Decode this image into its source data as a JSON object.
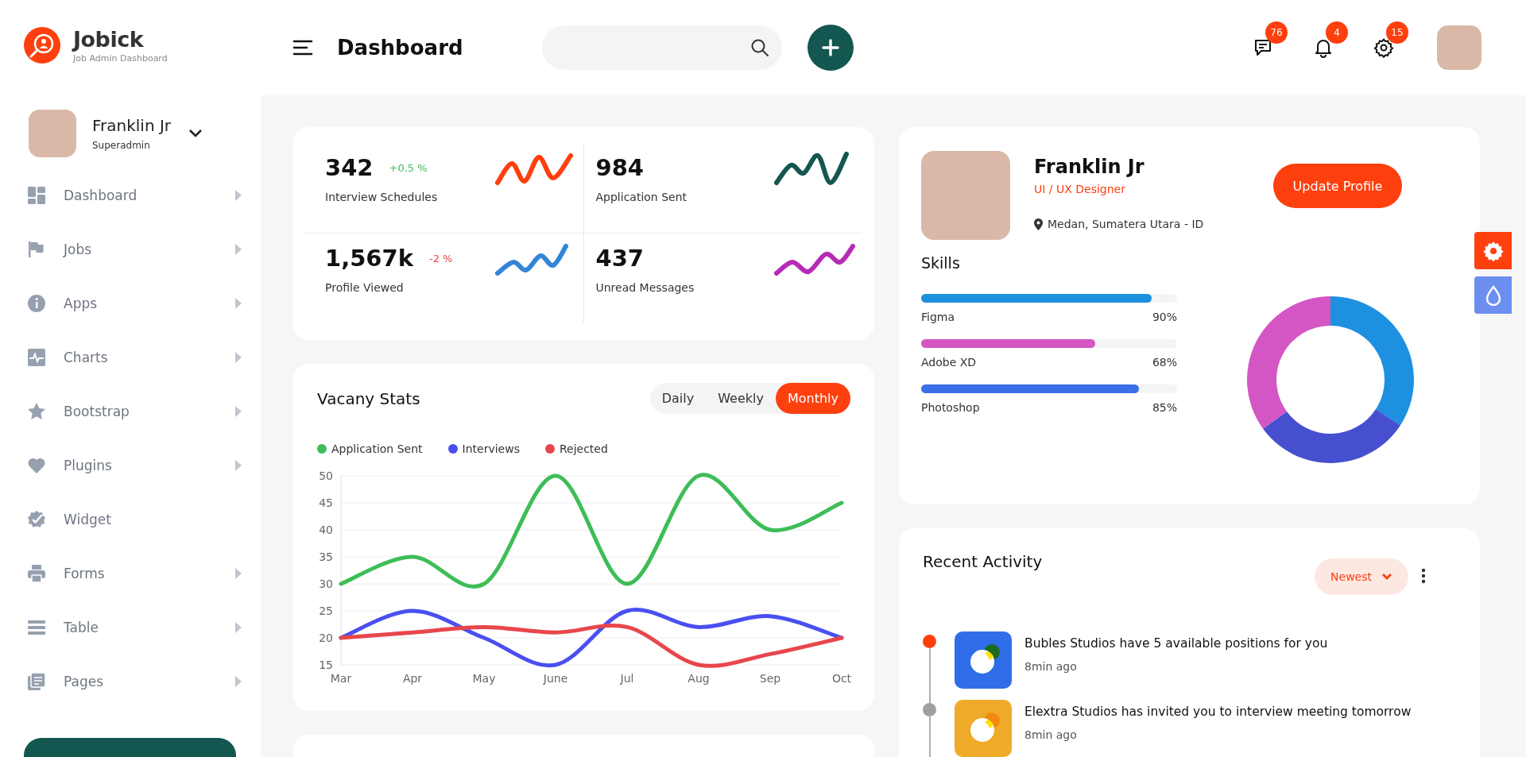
{
  "brand": {
    "name": "Jobick",
    "tagline": "Job Admin Dashboard"
  },
  "header": {
    "title": "Dashboard",
    "badges": [
      {
        "count": "76"
      },
      {
        "count": "4"
      },
      {
        "count": "15"
      }
    ]
  },
  "user": {
    "name": "Franklin Jr",
    "role": "Superadmin"
  },
  "sidebar": {
    "items": [
      {
        "label": "Dashboard",
        "has_submenu": true
      },
      {
        "label": "Jobs",
        "has_submenu": true
      },
      {
        "label": "Apps",
        "has_submenu": true
      },
      {
        "label": "Charts",
        "has_submenu": true
      },
      {
        "label": "Bootstrap",
        "has_submenu": true
      },
      {
        "label": "Plugins",
        "has_submenu": true
      },
      {
        "label": "Widget",
        "has_submenu": false
      },
      {
        "label": "Forms",
        "has_submenu": true
      },
      {
        "label": "Table",
        "has_submenu": true
      },
      {
        "label": "Pages",
        "has_submenu": true
      }
    ]
  },
  "stats": [
    {
      "value": "342",
      "change": {
        "text": "+0.5 %",
        "color": "#3ebd58"
      },
      "label": "Interview Schedules",
      "color": "#fe3f0e"
    },
    {
      "value": "984",
      "label": "Application Sent",
      "color": "#145650"
    },
    {
      "value": "1,567k",
      "change": {
        "text": "-2 %",
        "color": "#e8464b"
      },
      "label": "Profile Viewed",
      "color": "#3385d6"
    },
    {
      "value": "437",
      "label": "Unread Messages",
      "color": "#b62bb6"
    }
  ],
  "vacancy_stats": {
    "title": "Vacany Stats",
    "tabs": [
      {
        "label": "Daily",
        "selected": false
      },
      {
        "label": "Weekly",
        "selected": false
      },
      {
        "label": "Monthly",
        "selected": true
      }
    ],
    "chart_data": {
      "type": "line",
      "grid": true,
      "categories": [
        "Mar",
        "Apr",
        "May",
        "June",
        "Jul",
        "Aug",
        "Sep",
        "Oct"
      ],
      "ylim": [
        15,
        50
      ],
      "yticks": [
        15,
        20,
        25,
        30,
        35,
        40,
        45,
        50
      ],
      "series": [
        {
          "name": "Application Sent",
          "color": "#3ebd58",
          "values": [
            30,
            35,
            30,
            50,
            30,
            50,
            40,
            45
          ]
        },
        {
          "name": "Interviews",
          "color": "#4a4ff0",
          "values": [
            20,
            25,
            20,
            15,
            25,
            22,
            24,
            20
          ]
        },
        {
          "name": "Rejected",
          "color": "#e8464b",
          "values": [
            20,
            21,
            22,
            21,
            22,
            15,
            17,
            20
          ]
        }
      ]
    }
  },
  "profile": {
    "name": "Franklin Jr",
    "role": "UI / UX Designer",
    "location": "Medan, Sumatera Utara - ID",
    "button": "Update Profile",
    "skills_title": "Skills",
    "skills": [
      {
        "name": "Figma",
        "percent": "90%",
        "level": 0.9,
        "color": "#1e90e0"
      },
      {
        "name": "Adobe XD",
        "percent": "68%",
        "level": 0.68,
        "color": "#d455c4"
      },
      {
        "name": "Photoshop",
        "percent": "85%",
        "level": 0.85,
        "color": "#3b6fe8"
      }
    ]
  },
  "recent_activity": {
    "title": "Recent Activity",
    "sort": "Newest",
    "items": [
      {
        "text": "Bubles Studios have 5 available positions for you",
        "time": "8min ago",
        "color": "#2f6ee8",
        "active": true
      },
      {
        "text": "Elextra Studios has invited you to interview meeting tomorrow",
        "time": "8min ago",
        "color": "#f0aa2a",
        "active": false
      }
    ]
  }
}
